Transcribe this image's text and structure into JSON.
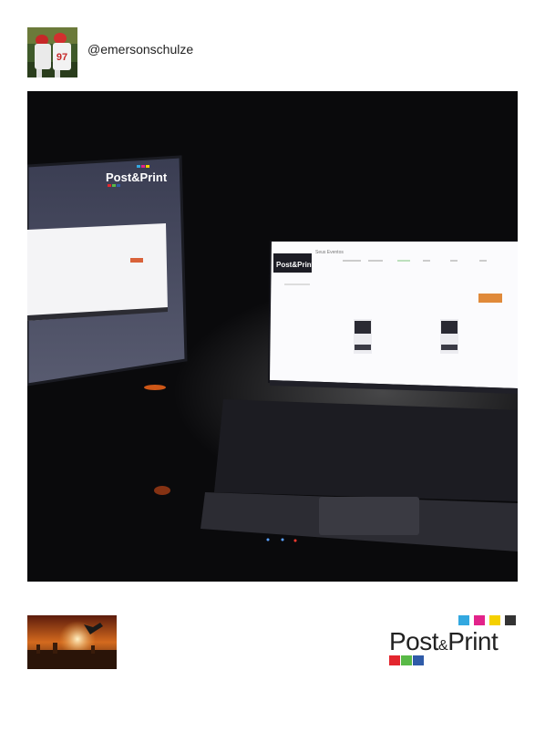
{
  "post": {
    "username": "@emersonschulze",
    "avatar_jersey_number": "97"
  },
  "photo": {
    "left_monitor": {
      "brand_text": "Post&Print",
      "button_color": "#d9623a"
    },
    "laptop_screen": {
      "title": "Seus Eventos",
      "brand_text": "Post&Print",
      "button_color": "#e08a3a"
    }
  },
  "brand": {
    "name_part1": "Post",
    "ampersand": "&",
    "name_part2": "Print",
    "top_squares": [
      "#33a8e0",
      "#e2238a",
      "#f5d000",
      "#333333"
    ],
    "bottom_squares": [
      "#e3262e",
      "#59b947",
      "#2f5ba8"
    ],
    "text_color": "#222222"
  }
}
